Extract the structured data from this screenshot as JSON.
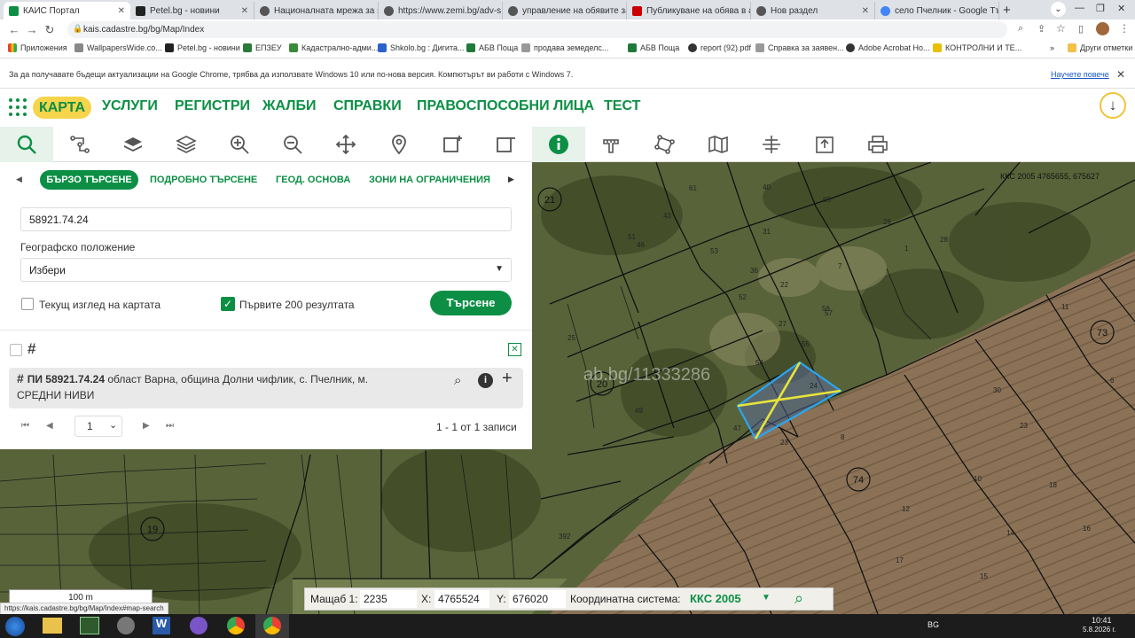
{
  "browser": {
    "tabs": [
      {
        "label": "КАИС Портал",
        "color": "#0c8f45"
      },
      {
        "label": "Petel.bg - новини",
        "color": "#222"
      },
      {
        "label": "Националната мрежа за з",
        "color": "#333"
      },
      {
        "label": "https://www.zemi.bg/adv-s",
        "color": "#444"
      },
      {
        "label": "управление на обявите за",
        "color": "#444"
      },
      {
        "label": "Публикуване на обява в а",
        "color": "#c00"
      },
      {
        "label": "Нов раздел",
        "color": "#444"
      },
      {
        "label": "село Пчелник - Google Тъ",
        "color": "#4285f4"
      }
    ],
    "url": "kais.cadastre.bg/bg/Map/Index",
    "bookmarks": [
      "Приложения",
      "WallpapersWide.co...",
      "Petel.bg - новини",
      "ЕПЗЕУ",
      "Кадастрално-адми...",
      "Shkolo.bg : Дигита...",
      "АБВ Поща",
      "продава земеделс...",
      "АБВ Поща",
      "report (92).pdf",
      "Справка за заявен...",
      "Adobe Acrobat Ho...",
      "КОНТРОЛНИ И ТЕ..."
    ],
    "other_bookmarks": "Други отметки",
    "infobar_text": "За да получавате бъдещи актуализации на Google Chrome, трябва да използвате Windows 10 или по-нова версия. Компютърът ви работи с Windows 7.",
    "infobar_link": "Научете повече",
    "status_url": "https://kais.cadastre.bg/bg/Map/Index#map-search"
  },
  "menu": {
    "items": [
      "КАРТА",
      "УСЛУГИ",
      "РЕГИСТРИ",
      "ЖАЛБИ",
      "СПРАВКИ",
      "ПРАВОСПОСОБНИ ЛИЦА",
      "ТЕСТ"
    ]
  },
  "toolbar": {
    "icons": [
      "search-icon",
      "route-icon",
      "layer-icon",
      "layers-icon",
      "zoom-in-icon",
      "zoom-out-icon",
      "pan-icon",
      "pin-icon",
      "rect-select-icon",
      "rect-clear-icon",
      "info-icon",
      "measure-icon",
      "polygon-icon",
      "map-icon",
      "coordinates-icon",
      "export-icon",
      "print-icon"
    ]
  },
  "search": {
    "tabs": [
      "БЪРЗО ТЪРСЕНЕ",
      "ПОДРОБНО ТЪРСЕНЕ",
      "ГЕОД. ОСНОВА",
      "ЗОНИ НА ОГРАНИЧЕНИЯ"
    ],
    "query": "58921.74.24",
    "geo_label": "Географско положение",
    "geo_value": "Избери",
    "current_view_label": "Текущ изглед на картата",
    "first200_label": "Първите 200 резултата",
    "search_button": "Търсене",
    "result_id": "ПИ 58921.74.24",
    "result_desc": " област Варна, община Долни чифлик, с. Пчелник, м. СРЕДНИ НИВИ",
    "page": "1",
    "records": "1 - 1 от 1 записи"
  },
  "map": {
    "coord_label": "ККС 2005 4765655, 675627",
    "watermark": "ab.bg/11333286",
    "circled_labels": [
      "21",
      "20",
      "73",
      "74",
      "19"
    ],
    "parcel_numbers": [
      "51",
      "53",
      "52",
      "22",
      "56",
      "57",
      "55",
      "54",
      "23",
      "24",
      "8",
      "10",
      "18",
      "16",
      "14",
      "12",
      "11",
      "6",
      "15",
      "17",
      "392",
      "43",
      "46",
      "49",
      "61",
      "31",
      "27",
      "25",
      "36",
      "40",
      "47",
      "65",
      "23",
      "7",
      "1",
      "26",
      "28",
      "30"
    ],
    "scale_label": "100 m"
  },
  "statusbar": {
    "scale_label": "Мащаб 1:",
    "scale_value": "2235",
    "x_label": "X:",
    "x_value": "4765524",
    "y_label": "Y:",
    "y_value": "676020",
    "crs_label": "Координатна система:",
    "crs_value": "ККС 2005"
  },
  "taskbar": {
    "lang": "BG",
    "time": "10:41",
    "date": "5.8.2026 г."
  }
}
